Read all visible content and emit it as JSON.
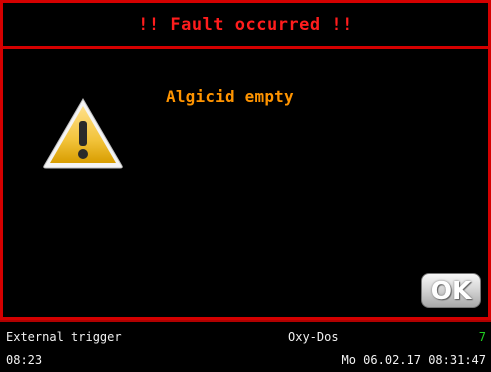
{
  "dialog": {
    "title": "!! Fault occurred !!",
    "message": "Algicid empty",
    "ok_label": "OK",
    "icon": "warning-triangle-icon"
  },
  "status_bar": {
    "trigger": "External trigger",
    "time": "08:23",
    "device": "Oxy-Dos",
    "channel": "7",
    "datetime": "Mo 06.02.17 08:31:47"
  },
  "colors": {
    "fault_red": "#d40000",
    "title_red": "#ff1d1d",
    "message_orange": "#ff9400",
    "channel_green": "#20d020"
  }
}
